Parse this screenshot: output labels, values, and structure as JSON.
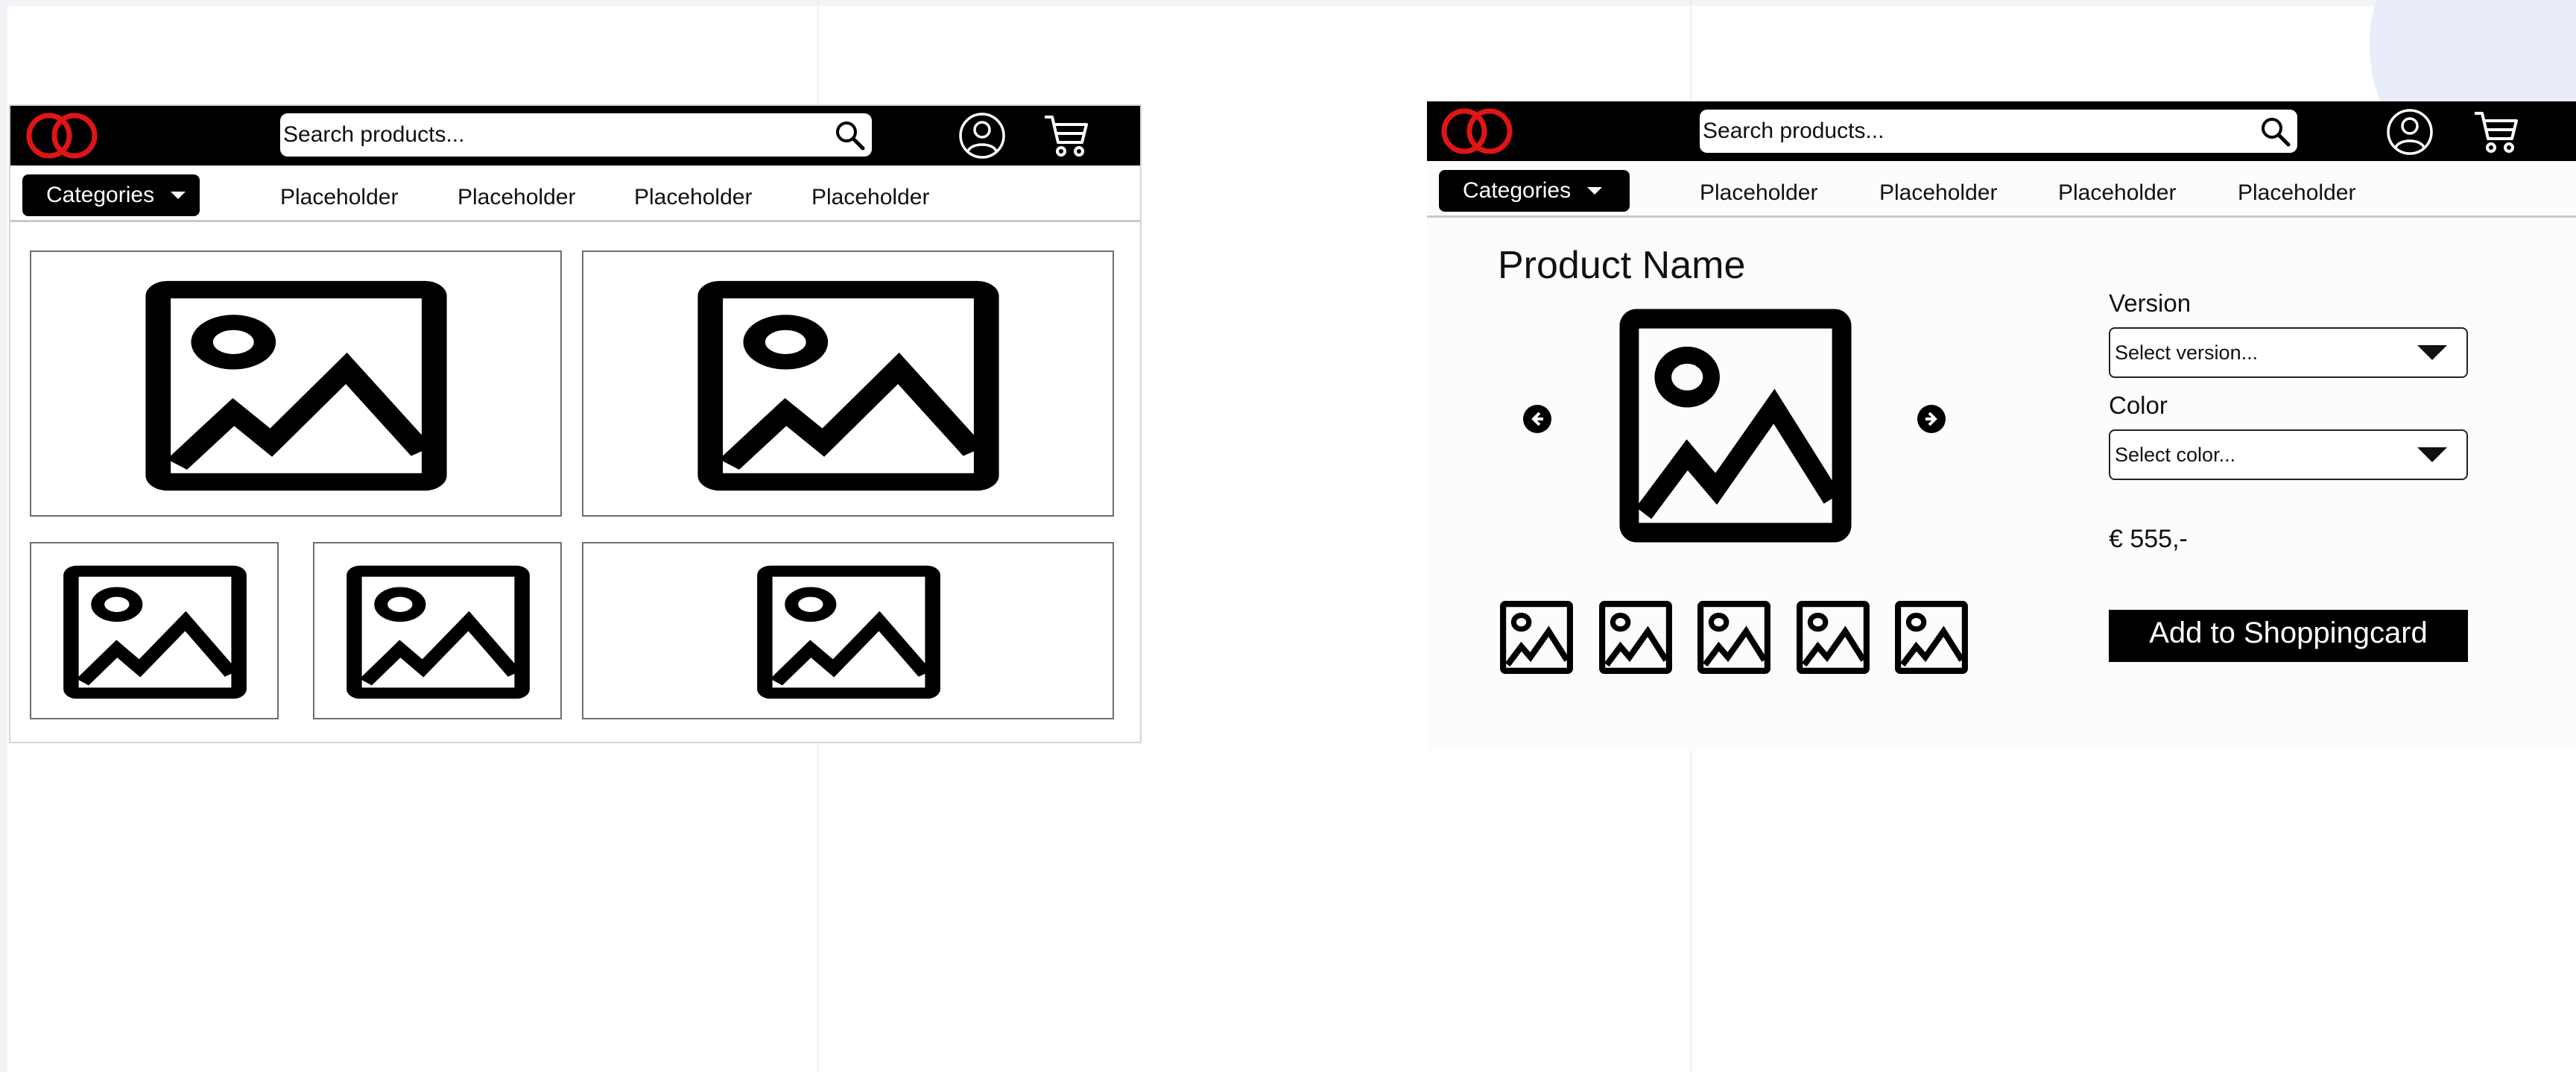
{
  "search": {
    "placeholder": "Search products..."
  },
  "nav": {
    "categories_label": "Categories",
    "items": [
      "Placeholder",
      "Placeholder",
      "Placeholder",
      "Placeholder"
    ]
  },
  "product": {
    "name": "Product Name",
    "version_label": "Version",
    "version_placeholder": "Select version...",
    "color_label": "Color",
    "color_placeholder": "Select color...",
    "price": "€ 555,-",
    "add_to_cart_label": "Add to Shoppingcard"
  },
  "icons": {
    "logo": "two-red-rings-logo",
    "search": "search-icon",
    "account": "user-circle-icon",
    "cart": "shopping-cart-icon",
    "image": "image-placeholder-icon",
    "prev": "arrow-left-icon",
    "next": "arrow-right-icon"
  },
  "colors": {
    "bar": "#000000",
    "logo": "#e01515",
    "page": "#ffffff"
  }
}
